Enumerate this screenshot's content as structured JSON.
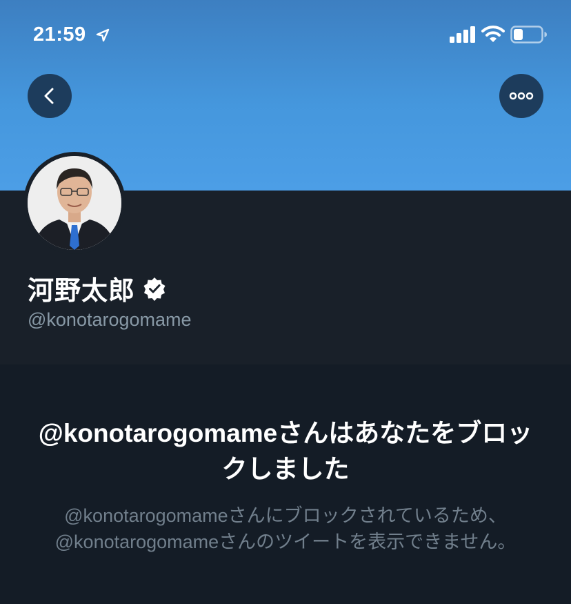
{
  "status_bar": {
    "time": "21:59",
    "icons": [
      "location-arrow-icon",
      "signal-icon",
      "wifi-icon",
      "battery-icon"
    ]
  },
  "header": {
    "back_icon": "chevron-left-icon",
    "more_icon": "ellipsis-icon",
    "banner_color": "#4597dd",
    "button_color": "#1d3c5c"
  },
  "profile": {
    "display_name": "河野太郎",
    "handle": "@konotarogomame",
    "verified": true
  },
  "blocked_notice": {
    "title": "@konotarogomameさんはあなたをブロックしました",
    "description": "@konotarogomameさんにブロックされているため、@konotarogomameさんのツイートを表示できません。"
  },
  "colors": {
    "background": "#141c26",
    "profile_background": "#192029",
    "secondary_text": "#8899a6"
  }
}
